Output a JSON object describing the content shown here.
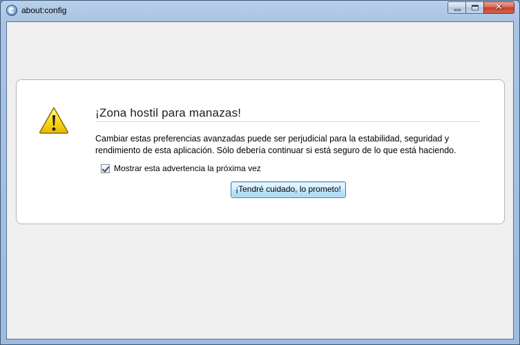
{
  "window": {
    "title": "about:config",
    "buttons": {
      "minimize_icon": "minimize-icon",
      "maximize_icon": "maximize-icon",
      "close_glyph": "✕"
    }
  },
  "warning": {
    "icon": "warning-triangle-icon",
    "title": "¡Zona hostil para manazas!",
    "message": "Cambiar estas preferencias avanzadas puede ser perjudicial para la estabilidad, seguridad y rendimiento de esta aplicación. Sólo debería continuar si está seguro de lo que está haciendo.",
    "checkbox_label": "Mostrar esta advertencia la próxima vez",
    "checkbox_checked": true,
    "confirm_label": "¡Tendré cuidado, lo prometo!"
  },
  "colors": {
    "close_button": "#c7402c",
    "frame": "#a9c4e3",
    "warning_yellow": "#f5d80b"
  }
}
